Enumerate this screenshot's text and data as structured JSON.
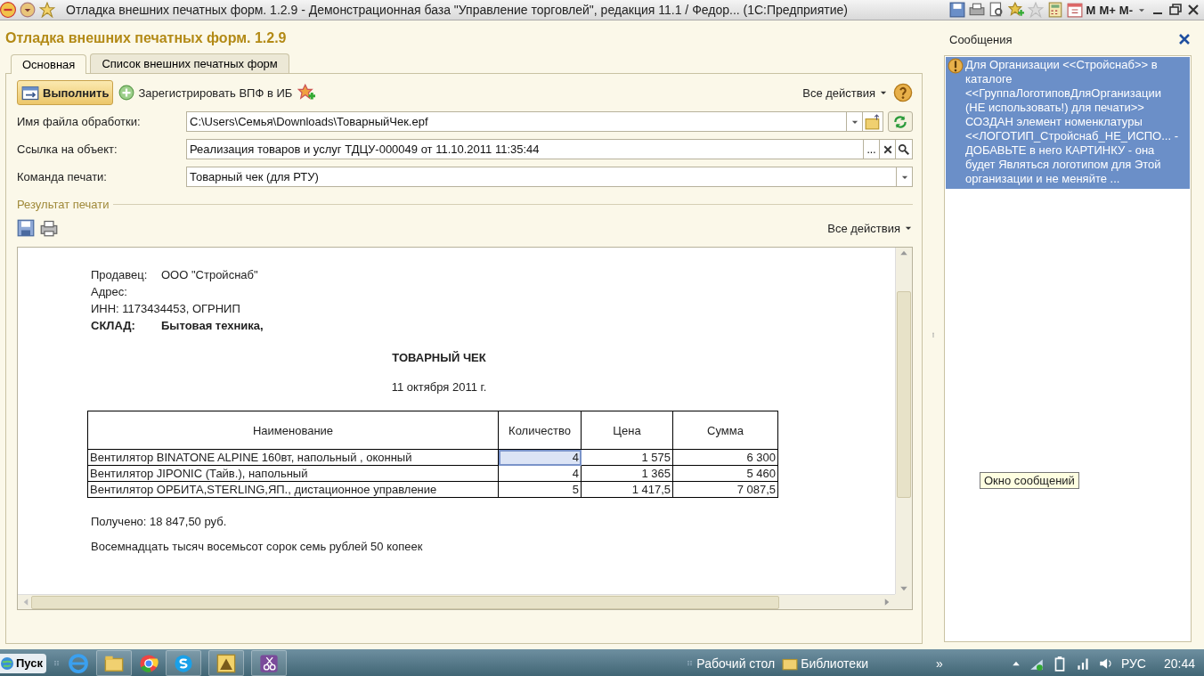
{
  "window": {
    "title": "Отладка внешних печатных форм. 1.2.9 - Демонстрационная база \"Управление торговлей\", редакция 11.1 / Федор...  (1С:Предприятие)",
    "memory_buttons": [
      "M",
      "M+",
      "M-"
    ]
  },
  "form": {
    "title": "Отладка внешних печатных форм. 1.2.9",
    "tabs": [
      {
        "label": "Основная",
        "selected": true
      },
      {
        "label": "Список внешних печатных форм",
        "selected": false
      }
    ],
    "toolbar": {
      "run_button": "Выполнить",
      "register_button": "Зарегистрировать ВПФ в ИБ",
      "all_actions": "Все действия"
    },
    "fields": [
      {
        "kind": "file",
        "label": "Имя файла обработки:",
        "value": "C:\\Users\\Семья\\Downloads\\ТоварныйЧек.epf"
      },
      {
        "kind": "reference",
        "label": "Ссылка на объект:",
        "value": "Реализация товаров и услуг ТДЦУ-000049 от 11.10.2011 11:35:44",
        "select_button": "..."
      },
      {
        "kind": "dropdown",
        "label": "Команда печати:",
        "value": "Товарный чек (для РТУ)"
      }
    ],
    "result": {
      "group_label": "Результат печати",
      "all_actions": "Все действия",
      "document": {
        "header": [
          {
            "kind": "plain",
            "label": "Продавец:",
            "value": "ООО \"Стройснаб\""
          },
          {
            "kind": "plain",
            "label": "Адрес:"
          },
          {
            "kind": "plain",
            "label": "ИНН: 1173434453, ОГРНИП"
          },
          {
            "kind": "bold",
            "label": "СКЛАД:",
            "value": "Бытовая техника,"
          }
        ],
        "title": "ТОВАРНЫЙ ЧЕК",
        "date": "11 октября 2011 г.",
        "columns": [
          "Наименование",
          "Количество",
          "Цена",
          "Сумма"
        ],
        "rows": [
          {
            "cells": [
              {
                "text": "Вентилятор BINATONE ALPINE 160вт, напольный , оконный",
                "selected": false
              },
              {
                "text": "4",
                "selected": true
              },
              {
                "text": "1 575",
                "selected": false
              },
              {
                "text": "6 300",
                "selected": false
              }
            ]
          },
          {
            "cells": [
              {
                "text": "Вентилятор JIPONIC (Тайв.), напольный",
                "selected": false
              },
              {
                "text": "4",
                "selected": false
              },
              {
                "text": "1 365",
                "selected": false
              },
              {
                "text": "5 460",
                "selected": false
              }
            ]
          },
          {
            "cells": [
              {
                "text": "Вентилятор ОРБИТА,STERLING,ЯП., дистационное управление",
                "selected": false
              },
              {
                "text": "5",
                "selected": false
              },
              {
                "text": "1 417,5",
                "selected": false
              },
              {
                "text": "7 087,5",
                "selected": false
              }
            ]
          }
        ],
        "received": "Получено: 18 847,50 руб.",
        "amount_words": "Восемнадцать тысяч восемьсот сорок семь рублей 50 копеек"
      }
    }
  },
  "messages": {
    "title": "Сообщения",
    "items": [
      {
        "text": "Для Организации <<Стройснаб>> в каталоге <<ГруппаЛоготиповДляОрганизации (НЕ использовать!) для печати>> СОЗДАН элемент номенклатуры <<ЛОГОТИП_Стройснаб_НЕ_ИСПО...  - ДОБАВЬТЕ в него КАРТИНКУ - она будет Являться логотипом для Этой организации и не меняйте ...",
        "selected": true
      }
    ],
    "tooltip": "Окно сообщений"
  },
  "taskbar": {
    "start": "Пуск",
    "toolbar_items": [
      "Рабочий стол",
      "Библиотеки"
    ],
    "chevron": "»",
    "language": "РУС",
    "time": "20:44"
  }
}
